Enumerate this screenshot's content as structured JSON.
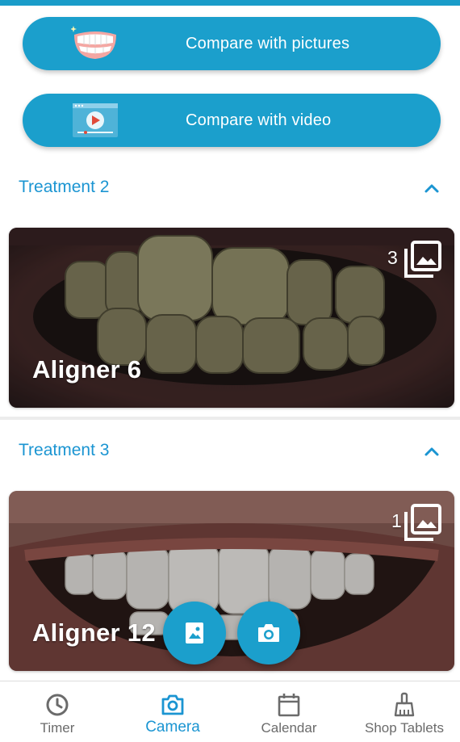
{
  "actions": {
    "compare_pictures_label": "Compare with pictures",
    "compare_video_label": "Compare with video"
  },
  "sections": [
    {
      "title": "Treatment 2",
      "card": {
        "title": "Aligner 6",
        "photo_count": "3"
      }
    },
    {
      "title": "Treatment 3",
      "card": {
        "title": "Aligner 12",
        "photo_count": "1"
      }
    }
  ],
  "fabs": {
    "gallery_icon": "photo-album-icon",
    "camera_icon": "camera-icon"
  },
  "bottom_nav": {
    "items": [
      {
        "label": "Timer",
        "icon": "clock-icon"
      },
      {
        "label": "Camera",
        "icon": "camera-icon",
        "active": true
      },
      {
        "label": "Calendar",
        "icon": "calendar-icon"
      },
      {
        "label": "Shop Tablets",
        "icon": "broom-icon"
      }
    ]
  },
  "colors": {
    "accent": "#1b9fcc",
    "active_nav": "#1b95d2",
    "text_muted": "#6b6b6b"
  }
}
